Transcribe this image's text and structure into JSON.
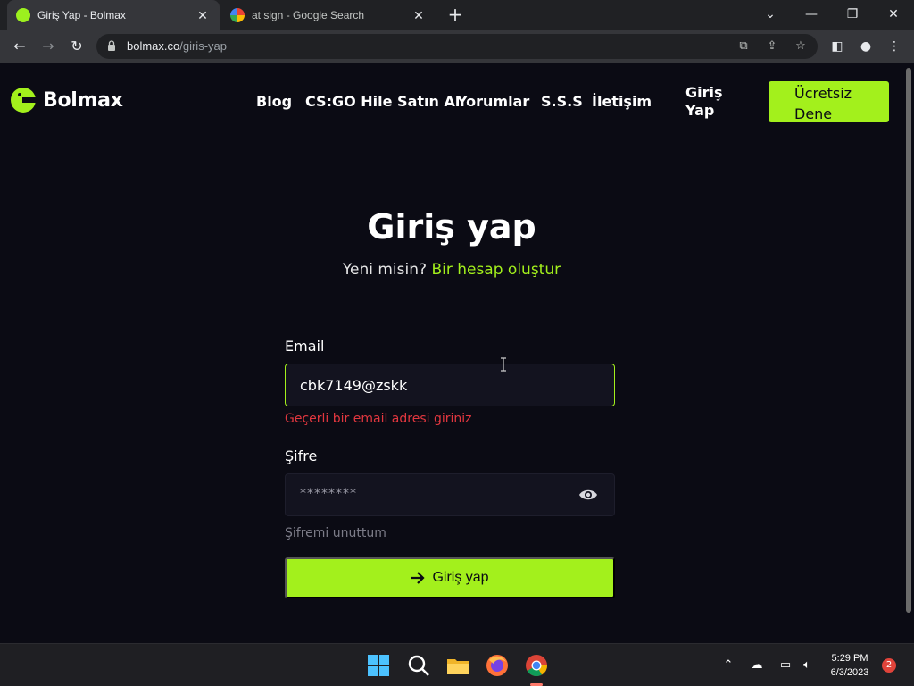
{
  "browser": {
    "tabs": [
      {
        "title": "Giriş Yap - Bolmax",
        "active": true
      },
      {
        "title": "at sign - Google Search",
        "active": false
      }
    ],
    "url_host": "bolmax.co",
    "url_path": "/giris-yap"
  },
  "site": {
    "logo_text": "Bolmax",
    "brand_color": "#a3f01c",
    "nav": [
      "Blog",
      "CS:GO Hile Satın Al",
      "Yorumlar",
      "S.S.S",
      "İletişim"
    ],
    "login_line1": "Giriş",
    "login_line2": "Yap",
    "cta_line1": "Ücretsiz",
    "cta_line2": "Dene"
  },
  "form": {
    "title": "Giriş yap",
    "subtitle_prefix": "Yeni misin?",
    "subtitle_link": "Bir hesap oluştur",
    "email_label": "Email",
    "email_value": "cbk7149@zskk",
    "email_error": "Geçerli bir email adresi giriniz",
    "password_label": "Şifre",
    "password_mask": "********",
    "forgot": "Şifremi unuttum",
    "submit": "Giriş yap",
    "error_color": "#e2373f"
  },
  "taskbar": {
    "time": "5:29 PM",
    "date": "6/3/2023",
    "notifications": "2"
  }
}
